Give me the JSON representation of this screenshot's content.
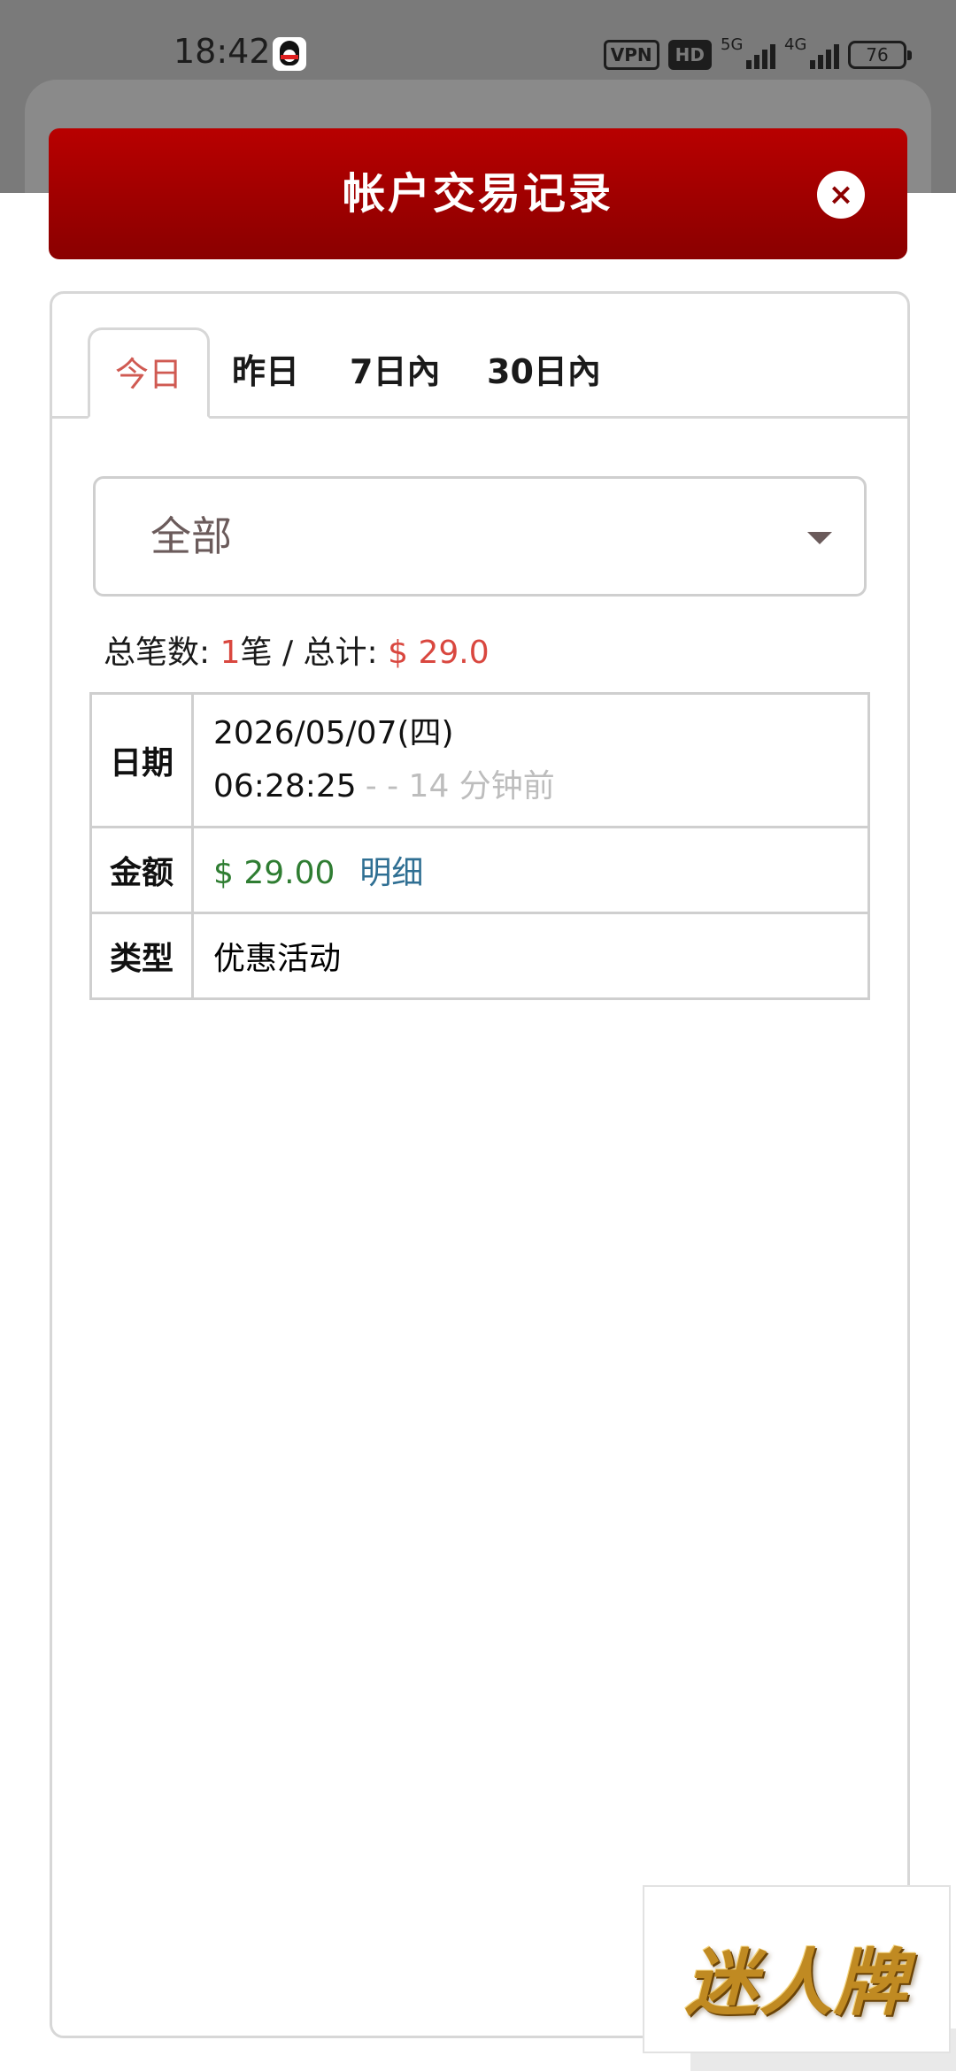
{
  "status_bar": {
    "time": "18:42",
    "vpn": "VPN",
    "hd": "HD",
    "net1": "5G",
    "net2": "4G",
    "battery": "76"
  },
  "modal": {
    "title": "帐户交易记录",
    "close_label": "×"
  },
  "tabs": [
    {
      "label": "今日",
      "active": true
    },
    {
      "label": "昨日",
      "active": false
    },
    {
      "label": "7日內",
      "active": false
    },
    {
      "label": "30日內",
      "active": false
    }
  ],
  "filter": {
    "selected": "全部"
  },
  "summary": {
    "count_label": "总笔数:",
    "count": "1",
    "count_unit": "笔 / 总计:",
    "total": "$ 29.0"
  },
  "record": {
    "date_label": "日期",
    "date": "2026/05/07(四)",
    "time": "06:28:25",
    "ago": "- - 14 分钟前",
    "amount_label": "金额",
    "amount": "$ 29.00",
    "detail_link": "明细",
    "type_label": "类型",
    "type": "优惠活动"
  },
  "badge": {
    "text": "迷人牌"
  },
  "colors": {
    "header_red": "#a00000",
    "active_tab": "#d05a52",
    "total_red": "#d9473f",
    "amount_green": "#2f7d32",
    "link_blue": "#2f6f93"
  }
}
